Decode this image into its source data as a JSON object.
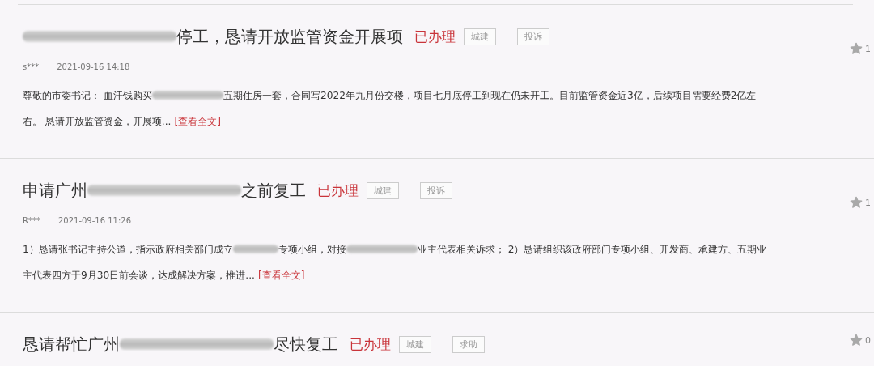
{
  "items": [
    {
      "title": [
        {
          "kind": "blur_wide"
        },
        {
          "kind": "text",
          "text": "停工，恳请开放监管资金开展项"
        }
      ],
      "status": "已办理",
      "tags": [
        "城建",
        "投诉"
      ],
      "likes": "1",
      "author": "s***",
      "time": "2021-09-16 14:18",
      "body": [
        [
          {
            "kind": "text",
            "text": "尊敬的市委书记： 血汗钱购买"
          },
          {
            "kind": "blur_narrow"
          },
          {
            "kind": "text",
            "text": "五期住房一套，合同写2022年九月份交楼，项目七月底停工到现在仍未开工。目前监管资金近3亿，后续项目需要经费2亿左"
          }
        ],
        [
          {
            "kind": "text",
            "text": "右。 恳请开放监管资金，开展项..."
          }
        ]
      ],
      "more": "[查看全文]"
    },
    {
      "title": [
        {
          "kind": "text",
          "text": "申请广州"
        },
        {
          "kind": "blur_wide"
        },
        {
          "kind": "text",
          "text": "之前复工"
        }
      ],
      "status": "已办理",
      "tags": [
        "城建",
        "投诉"
      ],
      "likes": "1",
      "author": "R***",
      "time": "2021-09-16 11:26",
      "body": [
        [
          {
            "kind": "text",
            "text": "1）恳请张书记主持公道，指示政府相关部门成立"
          },
          {
            "kind": "blur_small"
          },
          {
            "kind": "text",
            "text": "专项小组，对接"
          },
          {
            "kind": "blur_narrow"
          },
          {
            "kind": "text",
            "text": "业主代表相关诉求； 2）恳请组织该政府部门专项小组、开发商、承建方、五期业"
          }
        ],
        [
          {
            "kind": "text",
            "text": "主代表四方于9月30日前会谈，达成解决方案，推进..."
          }
        ]
      ],
      "more": "[查看全文]"
    },
    {
      "title": [
        {
          "kind": "text",
          "text": "恳请帮忙广州"
        },
        {
          "kind": "blur_wide"
        },
        {
          "kind": "text",
          "text": "尽快复工"
        }
      ],
      "status": "已办理",
      "tags": [
        "城建",
        "求助"
      ],
      "likes": "0"
    }
  ]
}
